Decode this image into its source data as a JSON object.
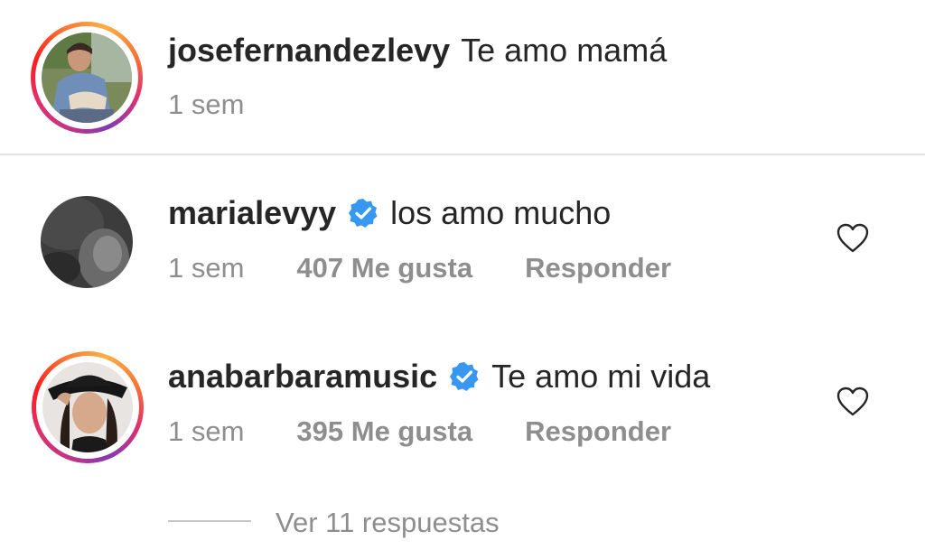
{
  "caption": {
    "username": "josefernandezlevy",
    "text": "Te amo mamá",
    "time": "1 sem",
    "has_story_ring": true
  },
  "comments": [
    {
      "username": "marialevyy",
      "verified": true,
      "text": "los amo mucho",
      "time": "1 sem",
      "likes": "407 Me gusta",
      "reply_label": "Responder",
      "has_story_ring": false
    },
    {
      "username": "anabarbaramusic",
      "verified": true,
      "text": "Te amo mi vida",
      "time": "1 sem",
      "likes": "395 Me gusta",
      "reply_label": "Responder",
      "has_story_ring": true
    }
  ],
  "view_replies": "Ver 11 respuestas",
  "icons": {
    "verified": "verified-badge-icon",
    "like": "heart-outline-icon"
  },
  "colors": {
    "verified_blue": "#3897f0",
    "username": "#262626",
    "secondary_text": "#8e8e8e",
    "divider": "#e3e3e3"
  }
}
